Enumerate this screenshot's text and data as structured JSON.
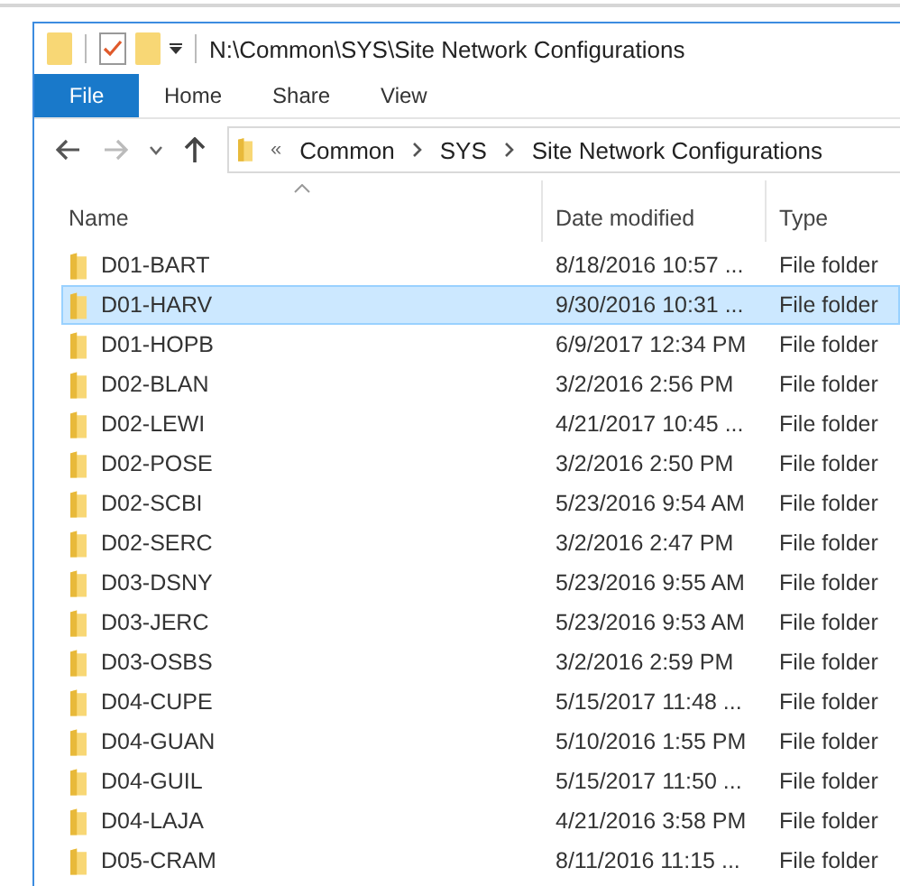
{
  "window": {
    "title": "N:\\Common\\SYS\\Site Network Configurations"
  },
  "ribbon": {
    "tabs": [
      {
        "label": "File",
        "kind": "file"
      },
      {
        "label": "Home",
        "kind": "tab"
      },
      {
        "label": "Share",
        "kind": "tab"
      },
      {
        "label": "View",
        "kind": "tab"
      }
    ]
  },
  "address_bar": {
    "overflow": "«",
    "breadcrumbs": [
      "Common",
      "SYS",
      "Site Network Configurations"
    ]
  },
  "table": {
    "columns": [
      {
        "label": "Name",
        "sorted": true
      },
      {
        "label": "Date modified",
        "sorted": false
      },
      {
        "label": "Type",
        "sorted": false
      }
    ],
    "rows": [
      {
        "name": "D01-BART",
        "date": "8/18/2016 10:57 ...",
        "type": "File folder",
        "selected": false
      },
      {
        "name": "D01-HARV",
        "date": "9/30/2016 10:31 ...",
        "type": "File folder",
        "selected": true
      },
      {
        "name": "D01-HOPB",
        "date": "6/9/2017 12:34 PM",
        "type": "File folder",
        "selected": false
      },
      {
        "name": "D02-BLAN",
        "date": "3/2/2016 2:56 PM",
        "type": "File folder",
        "selected": false
      },
      {
        "name": "D02-LEWI",
        "date": "4/21/2017 10:45 ...",
        "type": "File folder",
        "selected": false
      },
      {
        "name": "D02-POSE",
        "date": "3/2/2016 2:50 PM",
        "type": "File folder",
        "selected": false
      },
      {
        "name": "D02-SCBI",
        "date": "5/23/2016 9:54 AM",
        "type": "File folder",
        "selected": false
      },
      {
        "name": "D02-SERC",
        "date": "3/2/2016 2:47 PM",
        "type": "File folder",
        "selected": false
      },
      {
        "name": "D03-DSNY",
        "date": "5/23/2016 9:55 AM",
        "type": "File folder",
        "selected": false
      },
      {
        "name": "D03-JERC",
        "date": "5/23/2016 9:53 AM",
        "type": "File folder",
        "selected": false
      },
      {
        "name": "D03-OSBS",
        "date": "3/2/2016 2:59 PM",
        "type": "File folder",
        "selected": false
      },
      {
        "name": "D04-CUPE",
        "date": "5/15/2017 11:48 ...",
        "type": "File folder",
        "selected": false
      },
      {
        "name": "D04-GUAN",
        "date": "5/10/2016 1:55 PM",
        "type": "File folder",
        "selected": false
      },
      {
        "name": "D04-GUIL",
        "date": "5/15/2017 11:50 ...",
        "type": "File folder",
        "selected": false
      },
      {
        "name": "D04-LAJA",
        "date": "4/21/2016 3:58 PM",
        "type": "File folder",
        "selected": false
      },
      {
        "name": "D05-CRAM",
        "date": "8/11/2016 11:15 ...",
        "type": "File folder",
        "selected": false
      }
    ]
  }
}
